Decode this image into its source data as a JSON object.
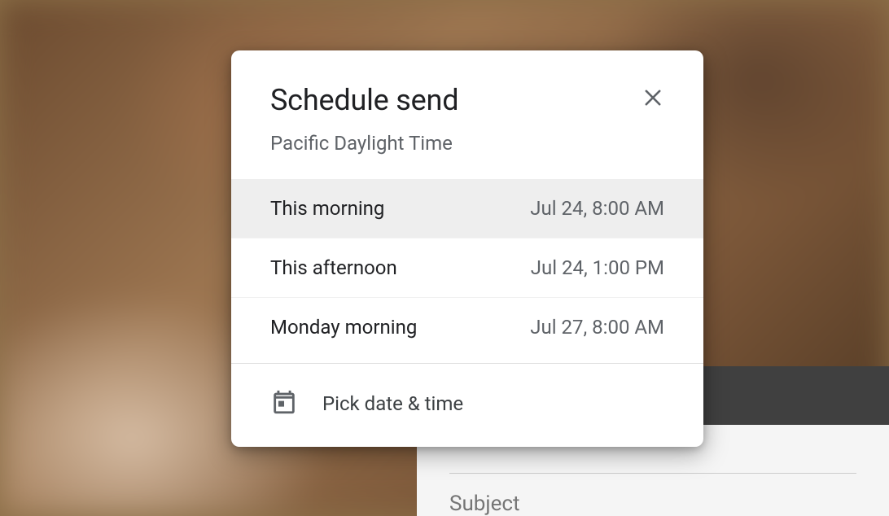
{
  "dialog": {
    "title": "Schedule send",
    "subtitle": "Pacific Daylight Time",
    "options": [
      {
        "label": "This morning",
        "time": "Jul 24, 8:00 AM"
      },
      {
        "label": "This afternoon",
        "time": "Jul 24, 1:00 PM"
      },
      {
        "label": "Monday morning",
        "time": "Jul 27, 8:00 AM"
      }
    ],
    "pick_label": "Pick date & time"
  },
  "compose": {
    "subject_placeholder": "Subject"
  }
}
